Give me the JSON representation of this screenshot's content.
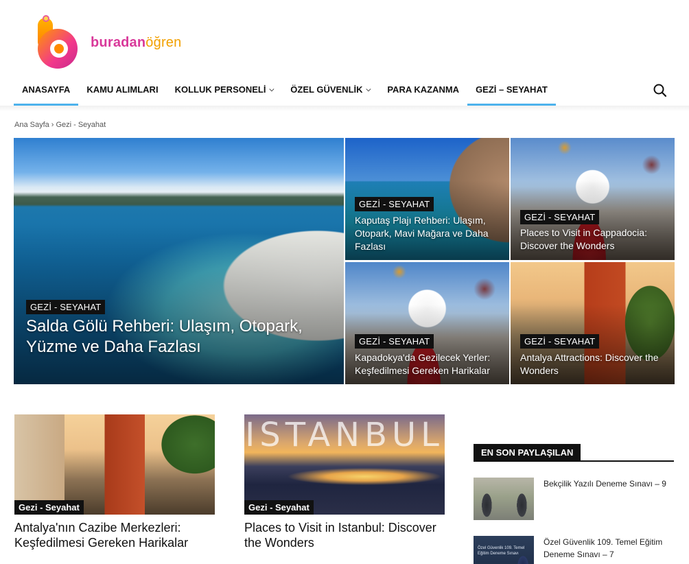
{
  "brand": {
    "logo_part1": "buradan",
    "logo_part2": "öğren"
  },
  "nav": {
    "items": [
      {
        "label": "ANASAYFA",
        "dropdown": false,
        "active": true
      },
      {
        "label": "KAMU ALIMLARI",
        "dropdown": false,
        "active": false
      },
      {
        "label": "KOLLUK PERSONELİ",
        "dropdown": true,
        "active": false
      },
      {
        "label": "ÖZEL GÜVENLİK",
        "dropdown": true,
        "active": false
      },
      {
        "label": "PARA KAZANMA",
        "dropdown": false,
        "active": false
      },
      {
        "label": "GEZİ – SEYAHAT",
        "dropdown": false,
        "active": true
      }
    ],
    "search_icon": "search-icon"
  },
  "breadcrumb": {
    "home": "Ana Sayfa",
    "separator": "›",
    "current": "Gezi - Seyahat"
  },
  "hero": {
    "main": {
      "category": "GEZİ - SEYAHAT",
      "title": "Salda Gölü Rehberi: Ulaşım, Otopark, Yüzme ve Daha Fazlası"
    },
    "tiles": [
      {
        "category": "GEZİ - SEYAHAT",
        "title": "Kaputaş Plajı Rehberi: Ulaşım, Otopark, Mavi Mağara ve Daha Fazlası"
      },
      {
        "category": "GEZİ - SEYAHAT",
        "title": "Places to Visit in Cappadocia: Discover the Wonders"
      },
      {
        "category": "GEZİ - SEYAHAT",
        "title": "Kapadokya'da Gezilecek Yerler: Keşfedilmesi Gereken Harikalar"
      },
      {
        "category": "GEZİ - SEYAHAT",
        "title": "Antalya Attractions: Discover the Wonders"
      }
    ]
  },
  "cards": [
    {
      "category": "Gezi - Seyahat",
      "title": "Antalya'nın Cazibe Merkezleri: Keşfedilmesi Gereken Harikalar"
    },
    {
      "category": "Gezi - Seyahat",
      "title": "Places to Visit in Istanbul: Discover the Wonders",
      "image_text": "ISTANBUL"
    }
  ],
  "sidebar": {
    "heading": "EN SON PAYLAŞILAN",
    "items": [
      {
        "title": "Bekçilik Yazılı Deneme Sınavı – 9"
      },
      {
        "title": "Özel Güvenlik 109. Temel Eğitim Deneme Sınavı – 7",
        "thumb_text": "Özel Güvenlik 109. Temel Eğitim Deneme Sınavı"
      }
    ]
  },
  "colors": {
    "accent": "#4db2ec",
    "badge_bg": "#111111",
    "brand_pink": "#d9399a",
    "brand_orange": "#f2a000"
  }
}
